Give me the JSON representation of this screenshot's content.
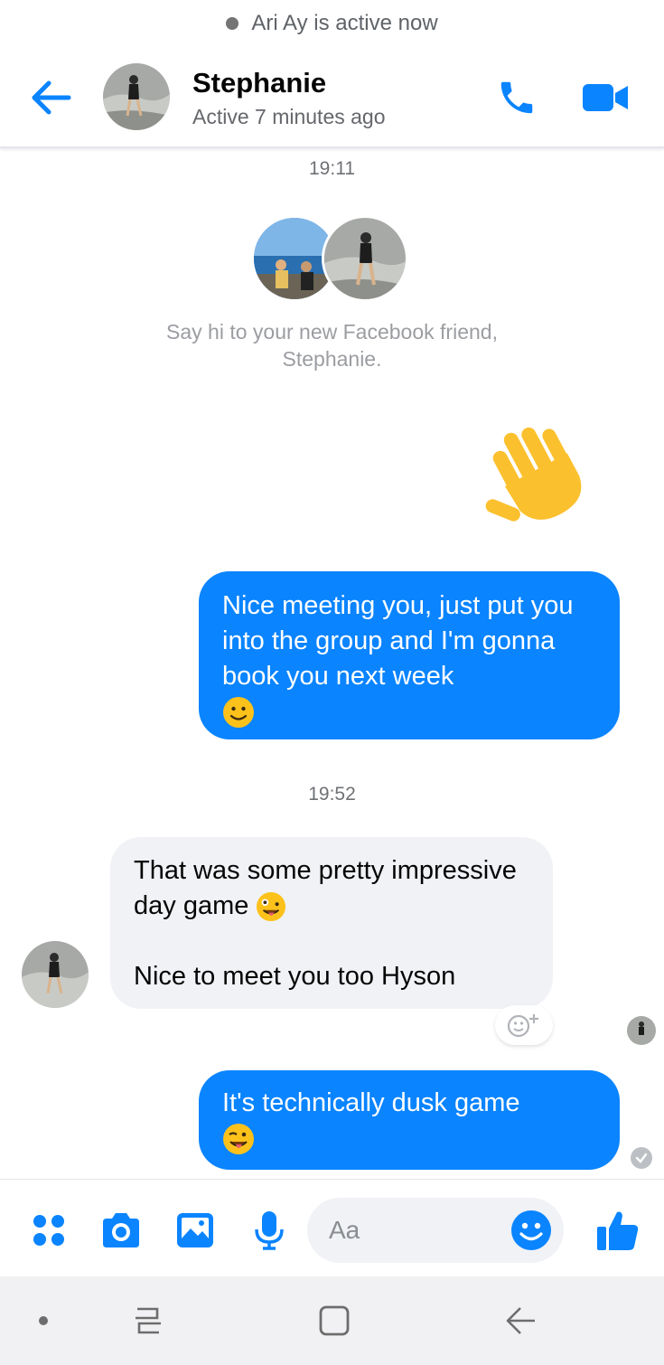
{
  "status": {
    "text": "Ari Ay is active now"
  },
  "header": {
    "name": "Stephanie",
    "subtitle": "Active 7 minutes ago",
    "back_icon": "arrow-left-icon",
    "call_icon": "phone-icon",
    "video_icon": "video-camera-icon",
    "accent_color": "#0a84ff"
  },
  "thread": {
    "timestamp_1": "19:11",
    "intro_text": "Say hi to your new Facebook friend, Stephanie.",
    "wave_icon": "waving-hand-emoji",
    "messages": [
      {
        "from": "me",
        "text": "Nice meeting you, just put you into the group and I'm gonna book you next week",
        "emoji": "slightly-smiling-face-emoji"
      },
      {
        "from": "Stephanie",
        "text_line_1": "That was some pretty impressive day game",
        "emoji_1": "zany-face-emoji",
        "text_line_2": "Nice to meet you too Hyson"
      },
      {
        "from": "me",
        "text": "It's technically dusk game",
        "emoji": "winking-tongue-face-emoji"
      }
    ],
    "timestamp_2": "19:52",
    "react_icon": "add-reaction-icon",
    "delivered_icon": "check-circle-icon"
  },
  "composer": {
    "placeholder": "Aa",
    "icons": [
      "apps-icon",
      "camera-icon",
      "gallery-icon",
      "microphone-icon",
      "emoji-icon",
      "thumbs-up-icon"
    ]
  },
  "navbar": {
    "icons": [
      "dot-icon",
      "recent-apps-icon",
      "home-icon",
      "back-icon"
    ],
    "background": "#f1f1f3"
  }
}
